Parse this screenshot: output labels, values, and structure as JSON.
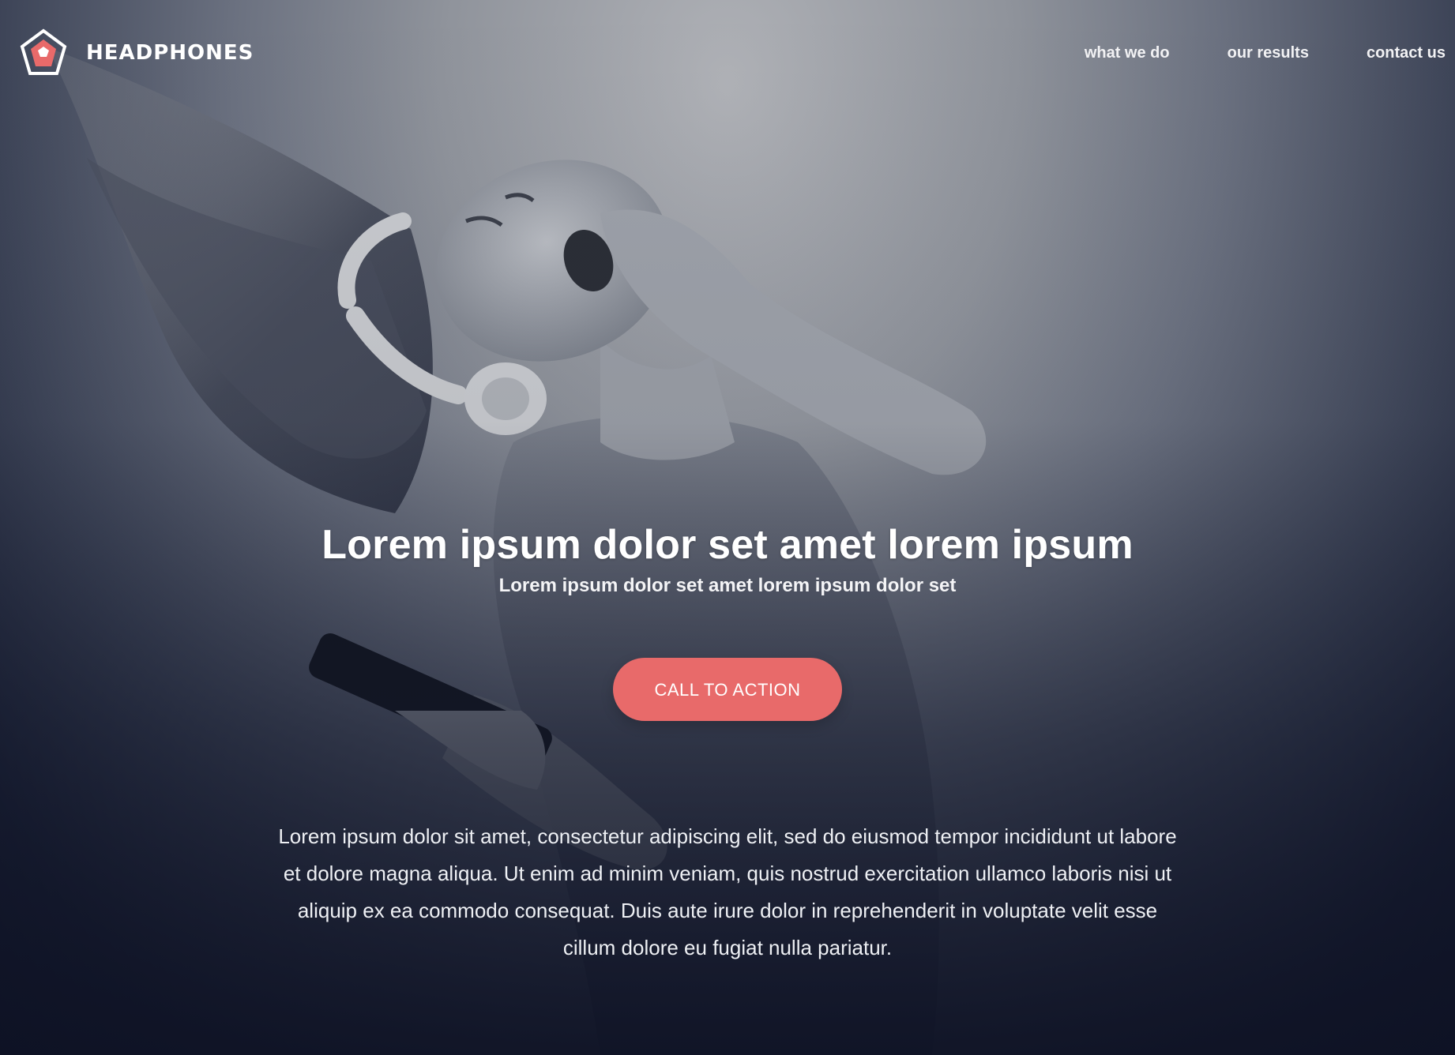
{
  "brand": {
    "name": "HEADPHONES",
    "logo_icon": "pentagon-logo-icon",
    "accent_color": "#e86a6a"
  },
  "nav": {
    "items": [
      {
        "label": "what we do"
      },
      {
        "label": "our results"
      },
      {
        "label": "contact us"
      }
    ]
  },
  "hero": {
    "title": "Lorem ipsum dolor set amet lorem ipsum",
    "subtitle": "Lorem ipsum dolor set amet lorem ipsum dolor set",
    "cta_label": "CALL TO ACTION",
    "body": "Lorem ipsum dolor sit amet, consectetur adipiscing elit, sed do eiusmod tempor incididunt ut labore et dolore magna aliqua. Ut enim ad minim veniam, quis nostrud exercitation ullamco laboris nisi ut aliquip ex ea commodo consequat. Duis aute irure dolor in reprehenderit in voluptate velit esse cillum dolore eu fugiat nulla pariatur."
  },
  "colors": {
    "background_top": "#b0b2b7",
    "background_bottom": "#11162a",
    "cta_background": "#e86a6a",
    "text": "#ffffff"
  }
}
